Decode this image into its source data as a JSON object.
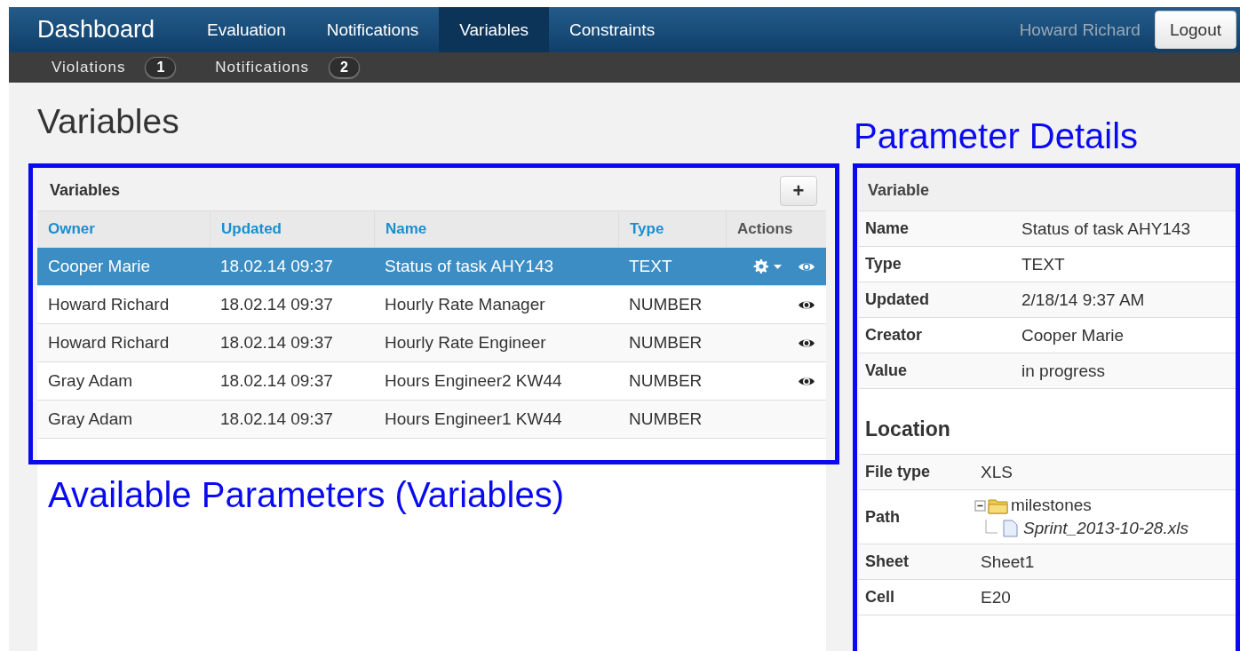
{
  "navbar": {
    "brand": "Dashboard",
    "items": [
      {
        "label": "Evaluation",
        "selected": false
      },
      {
        "label": "Notifications",
        "selected": false
      },
      {
        "label": "Variables",
        "selected": true
      },
      {
        "label": "Constraints",
        "selected": false
      }
    ],
    "user": "Howard Richard",
    "logout": "Logout"
  },
  "subnav": [
    {
      "label": "Violations",
      "count": "1"
    },
    {
      "label": "Notifications",
      "count": "2"
    }
  ],
  "page_title": "Variables",
  "variables_panel": {
    "title": "Variables",
    "add_button": "+",
    "columns": [
      {
        "label": "Owner",
        "sortable": true
      },
      {
        "label": "Updated",
        "sortable": true
      },
      {
        "label": "Name",
        "sortable": true
      },
      {
        "label": "Type",
        "sortable": true
      },
      {
        "label": "Actions",
        "sortable": false
      }
    ],
    "rows": [
      {
        "owner": "Cooper Marie",
        "updated": "18.02.14 09:37",
        "name": "Status of task AHY143",
        "type": "TEXT",
        "selected": true,
        "has_settings": true,
        "has_view": true
      },
      {
        "owner": "Howard Richard",
        "updated": "18.02.14 09:37",
        "name": "Hourly Rate Manager",
        "type": "NUMBER",
        "selected": false,
        "has_settings": false,
        "has_view": true
      },
      {
        "owner": "Howard Richard",
        "updated": "18.02.14 09:37",
        "name": "Hourly Rate Engineer",
        "type": "NUMBER",
        "selected": false,
        "has_settings": false,
        "has_view": true
      },
      {
        "owner": "Gray Adam",
        "updated": "18.02.14 09:37",
        "name": "Hours Engineer2 KW44",
        "type": "NUMBER",
        "selected": false,
        "has_settings": false,
        "has_view": true
      },
      {
        "owner": "Gray Adam",
        "updated": "18.02.14 09:37",
        "name": "Hours Engineer1 KW44",
        "type": "NUMBER",
        "selected": false,
        "has_settings": false,
        "has_view": false
      }
    ]
  },
  "details_panel": {
    "title": "Variable",
    "fields": [
      {
        "label": "Name",
        "value": "Status of task AHY143"
      },
      {
        "label": "Type",
        "value": "TEXT"
      },
      {
        "label": "Updated",
        "value": "2/18/14 9:37 AM"
      },
      {
        "label": "Creator",
        "value": "Cooper Marie"
      },
      {
        "label": "Value",
        "value": "in progress"
      }
    ],
    "location_title": "Location",
    "location": [
      {
        "kind": "text",
        "label": "File type",
        "value": "XLS"
      },
      {
        "kind": "tree",
        "label": "Path",
        "tree": {
          "name": "milestones",
          "expanded": true,
          "children": [
            {
              "name": "Sprint_2013-10-28.xls"
            }
          ]
        }
      },
      {
        "kind": "text",
        "label": "Sheet",
        "value": "Sheet1"
      },
      {
        "kind": "text",
        "label": "Cell",
        "value": "E20"
      }
    ]
  },
  "annotations": {
    "details_label": "Parameter Details",
    "variables_label": "Available Parameters (Variables)"
  }
}
